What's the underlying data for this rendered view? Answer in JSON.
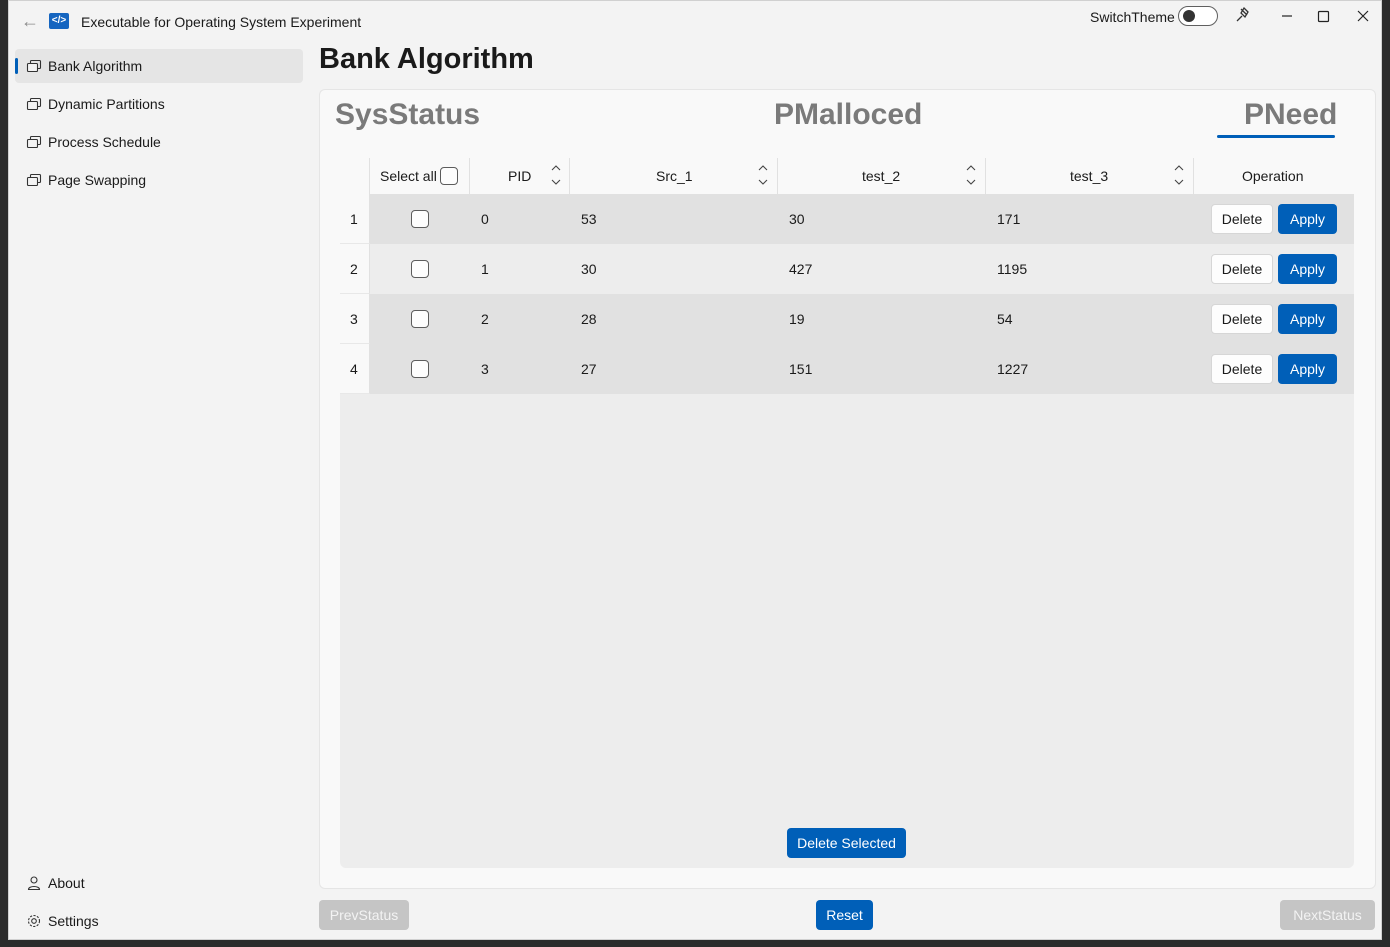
{
  "window": {
    "title": "Executable for Operating System Experiment",
    "theme_switch_label": "SwitchTheme"
  },
  "sidebar": {
    "items": [
      {
        "label": "Bank Algorithm",
        "icon": "window-stack-icon",
        "selected": true
      },
      {
        "label": "Dynamic Partitions",
        "icon": "window-stack-icon",
        "selected": false
      },
      {
        "label": "Process Schedule",
        "icon": "window-stack-icon",
        "selected": false
      },
      {
        "label": "Page Swapping",
        "icon": "window-stack-icon",
        "selected": false
      }
    ],
    "footer": [
      {
        "label": "About",
        "icon": "person-icon"
      },
      {
        "label": "Settings",
        "icon": "gear-icon"
      }
    ]
  },
  "page": {
    "title": "Bank Algorithm"
  },
  "tabs": [
    {
      "label": "SysStatus",
      "selected": false
    },
    {
      "label": "PMalloced",
      "selected": false
    },
    {
      "label": "PNeed",
      "selected": true
    }
  ],
  "grid": {
    "headers": {
      "select_all": "Select all",
      "pid": "PID",
      "src_1": "Src_1",
      "test_2": "test_2",
      "test_3": "test_3",
      "operation": "Operation"
    },
    "rows": [
      {
        "index": "1",
        "pid": "0",
        "src_1": "53",
        "test_2": "30",
        "test_3": "171"
      },
      {
        "index": "2",
        "pid": "1",
        "src_1": "30",
        "test_2": "427",
        "test_3": "1195"
      },
      {
        "index": "3",
        "pid": "2",
        "src_1": "28",
        "test_2": "19",
        "test_3": "54"
      },
      {
        "index": "4",
        "pid": "3",
        "src_1": "27",
        "test_2": "151",
        "test_3": "1227"
      }
    ],
    "delete_label": "Delete",
    "apply_label": "Apply",
    "delete_selected_label": "Delete Selected"
  },
  "footer_buttons": {
    "prev": "PrevStatus",
    "reset": "Reset",
    "next": "NextStatus"
  },
  "colors": {
    "accent": "#005fb8",
    "disabled": "#c5c5c5"
  }
}
